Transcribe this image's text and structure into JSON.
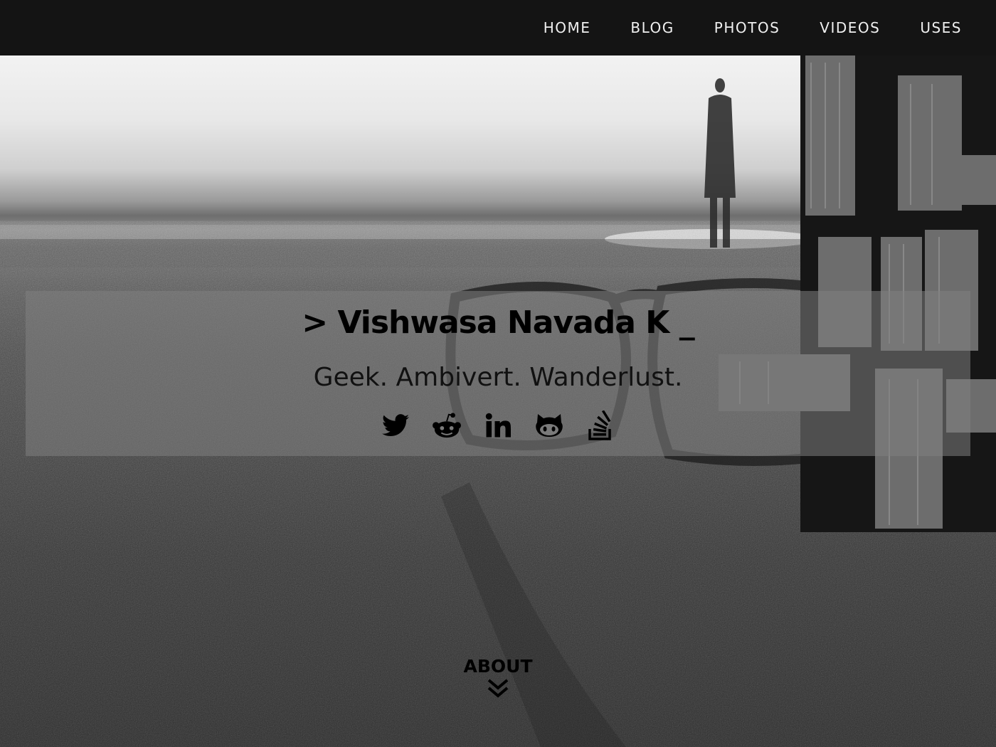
{
  "nav": {
    "items": [
      {
        "label": "HOME"
      },
      {
        "label": "BLOG"
      },
      {
        "label": "PHOTOS"
      },
      {
        "label": "VIDEOS"
      },
      {
        "label": "USES"
      }
    ]
  },
  "intro": {
    "title": "> Vishwasa Navada K _",
    "tagline": "Geek. Ambivert. Wanderlust.",
    "social": [
      {
        "icon": "twitter-icon"
      },
      {
        "icon": "reddit-icon"
      },
      {
        "icon": "linkedin-icon"
      },
      {
        "icon": "github-icon"
      },
      {
        "icon": "stackoverflow-icon"
      }
    ]
  },
  "about": {
    "label": "ABOUT",
    "icon": "double-chevron-down-icon"
  },
  "colors": {
    "navbar": "#141414",
    "nav_text": "#f0f0f0",
    "overlay": "rgba(128,128,128,0.55)",
    "text": "#000000"
  }
}
